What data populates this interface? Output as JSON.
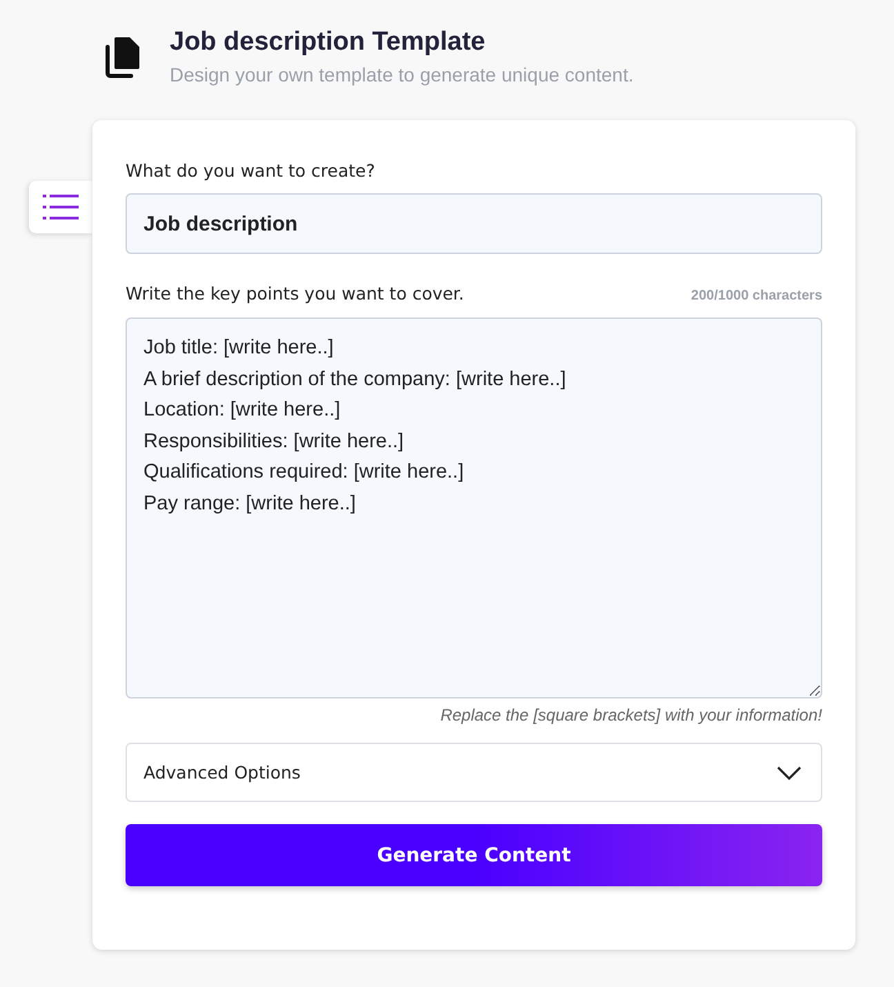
{
  "header": {
    "title": "Job description Template",
    "subtitle": "Design your own template to generate unique content."
  },
  "form": {
    "topic": {
      "label": "What do you want to create?",
      "value": "Job description"
    },
    "key_points": {
      "label": "Write the key points you want to cover.",
      "counter": "200/1000 characters",
      "value_lines": [
        "Job title: [write here..]",
        "A brief description of the company: [write here..]",
        "Location: [write here..]",
        "Responsibilities: [write here..]",
        "Qualifications required: [write here..]",
        "Pay range: [write here..]"
      ],
      "hint": "Replace the [square brackets] with your information!"
    },
    "advanced_options": {
      "label": "Advanced Options",
      "expanded": false
    },
    "submit_button": "Generate Content"
  }
}
